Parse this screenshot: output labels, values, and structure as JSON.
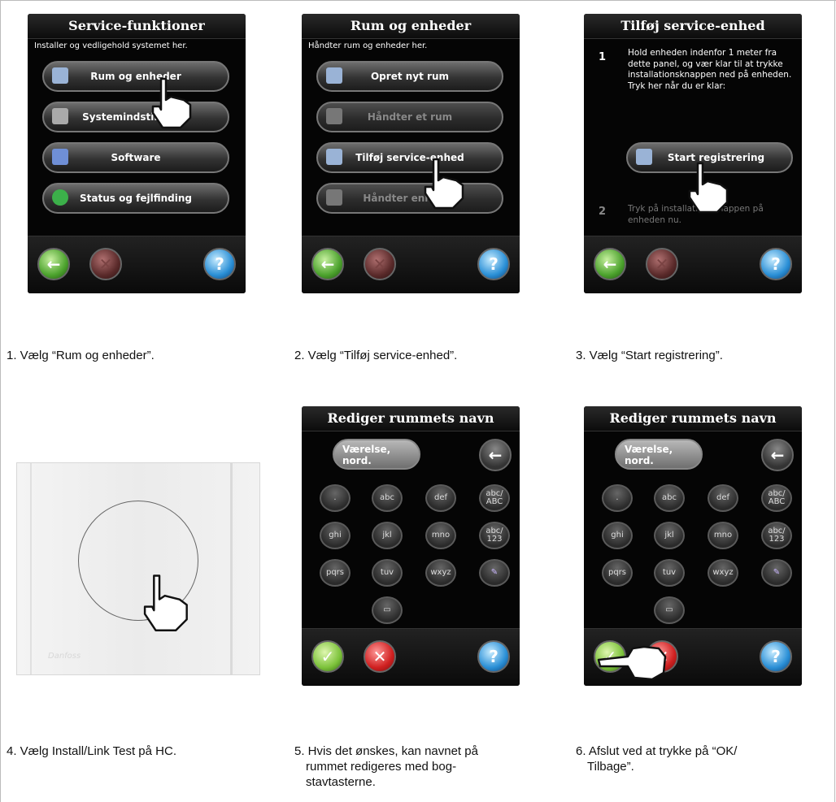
{
  "panels": [
    {
      "title": "Service-funktioner",
      "subtitle": "Installer og vedligehold systemet her.",
      "buttons": [
        "Rum og enheder",
        "Systemindstillinger",
        "Software",
        "Status og fejlfinding"
      ],
      "caption": "1. Vælg “Rum og enheder”."
    },
    {
      "title": "Rum og enheder",
      "subtitle": "Håndter rum og enheder her.",
      "buttons": [
        "Opret nyt rum",
        "Håndter et rum",
        "Tilføj service-enhed",
        "Håndter enheder"
      ],
      "caption": "2. Vælg “Tilføj service-enhed”."
    },
    {
      "title": "Tilføj service-enhed",
      "step1_num": "1",
      "step1_text": "Hold enheden indenfor 1 meter fra dette panel, og vær klar til at trykke installationsknappen ned på enheden. Tryk her når du er klar:",
      "button": "Start registrering",
      "step2_num": "2",
      "step2_text": "Tryk på installationsknappen på enheden nu.",
      "caption": "3. Vælg “Start registrering”."
    },
    {
      "caption": "4. Vælg Install/Link Test på HC.",
      "logo": "Danfoss"
    },
    {
      "title": "Rediger rummets navn",
      "name_value_l1": "Værelse,",
      "name_value_l2": "nord.",
      "keys": [
        ".",
        "abc",
        "def",
        "ghi",
        "jkl",
        "mno",
        "pqrs",
        "tuv",
        "wxyz"
      ],
      "key_case_1": "abc/",
      "key_case_2": "ABC",
      "key_num_1": "abc/",
      "key_num_2": "123",
      "caption_l1": "5. Hvis det ønskes, kan navnet på",
      "caption_l2": "rummet redigeres med bog-",
      "caption_l3": "stavtasterne."
    },
    {
      "title": "Rediger rummets navn",
      "name_value_l1": "Værelse,",
      "name_value_l2": "nord.",
      "keys": [
        ".",
        "abc",
        "def",
        "ghi",
        "jkl",
        "mno",
        "pqrs",
        "tuv",
        "wxyz"
      ],
      "key_case_1": "abc/",
      "key_case_2": "ABC",
      "key_num_1": "abc/",
      "key_num_2": "123",
      "caption_l1": "6.  Afslut ved at trykke på “OK/",
      "caption_l2": "Tilbage”."
    }
  ],
  "icons": {
    "back": "arrow-left-icon",
    "cancel": "close-icon",
    "help": "help-icon",
    "ok": "checkmark-icon",
    "backspace": "backspace-icon",
    "keyboard": "keyboard-icon",
    "space": "space-icon",
    "pointer": "pointing-hand-icon"
  },
  "colors": {
    "screen_bg": "#050505",
    "back_green": "#4ca22d",
    "help_blue": "#2a8fd6",
    "cancel_red": "#d02020"
  }
}
